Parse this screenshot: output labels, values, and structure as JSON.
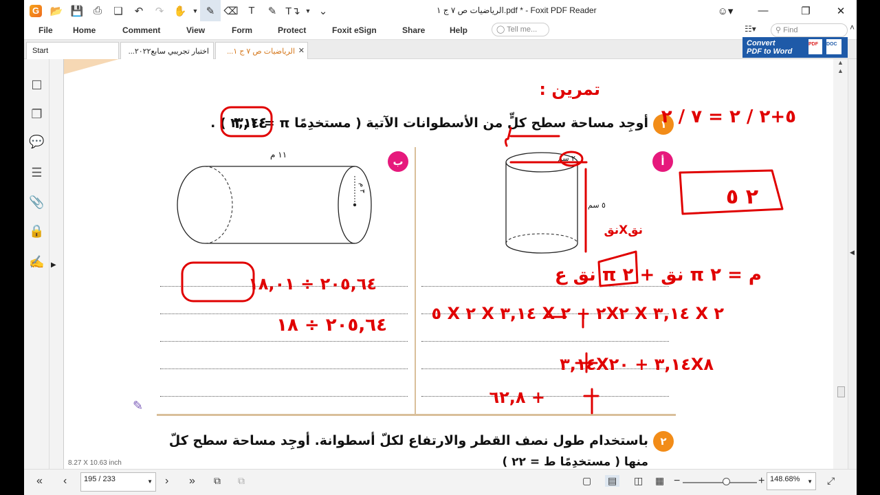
{
  "titlebar": {
    "title": "الرياضيات ص ٧ ج ١.pdf * - Foxit PDF Reader",
    "logo_letter": "G"
  },
  "menu": [
    "File",
    "Home",
    "Comment",
    "View",
    "Form",
    "Protect",
    "Foxit eSign",
    "Share",
    "Help"
  ],
  "search": {
    "tell_me_placeholder": "Tell me...",
    "find_placeholder": "Find"
  },
  "tabs": [
    {
      "label": "Start"
    },
    {
      "label": "اختبار تجريبي سابع٢٠٢٢..."
    },
    {
      "label": "الرياضيات ص ٧ ج ١..."
    }
  ],
  "convert_banner": {
    "line1": "Convert",
    "line2": "PDF to Word",
    "badge_left": "PDF",
    "badge_right": "DOC"
  },
  "worksheet": {
    "q1_number": "١",
    "q1_text": "أوجِد مساحة سطح كلٍّ من الأسطوانات الآتية ( مستخدِمًا π = ٣,١٤ ) .",
    "label_a": "أ",
    "label_b": "ب",
    "cyl_a_radius": "٢ سم",
    "cyl_a_height": "٥ سم",
    "cyl_b_length": "١١ م",
    "cyl_b_radius": "٣ م",
    "q2_number": "٢",
    "q2_text": "باستخدام طول نصف القطر والارتفاع لكلّ أسطوانة. أوجِد مساحة سطح كلّ",
    "q2_text2": "منها ( مستخدِمًا ط = ٢٢ )",
    "page_size": "8.27 X 10.63 inch"
  },
  "handwriting": {
    "title": "تمرين :",
    "fraction": "٥+٢ / ٢ = ٧ / ٢",
    "boxed": "٢ ٥",
    "boxed_pi": "٣,١٤",
    "formula": "م = ٢ π نق + ٢ π نق ع",
    "side": "نقXنق",
    "step1": "٢ X ٣,١٤ X ٢X٢ + ٢ X ٣,١٤ X ٢ X ٥",
    "step2": "٣,١٤X٨ + ٣,١٤X٢٠",
    "step3": "+ ٦٢,٨",
    "b_line1": "٢٠٥,٦٤ ÷ ١٨,٠١",
    "b_line2": "٢٠٥,٦٤ ÷ ١٨"
  },
  "bottombar": {
    "page_indicator": "195 / 233",
    "zoom": "148.68%"
  },
  "colors": {
    "accent_orange": "#f28c18",
    "badge_magenta": "#e6197c",
    "ink_red": "#e00000",
    "convert_blue": "#1e5aa8"
  }
}
